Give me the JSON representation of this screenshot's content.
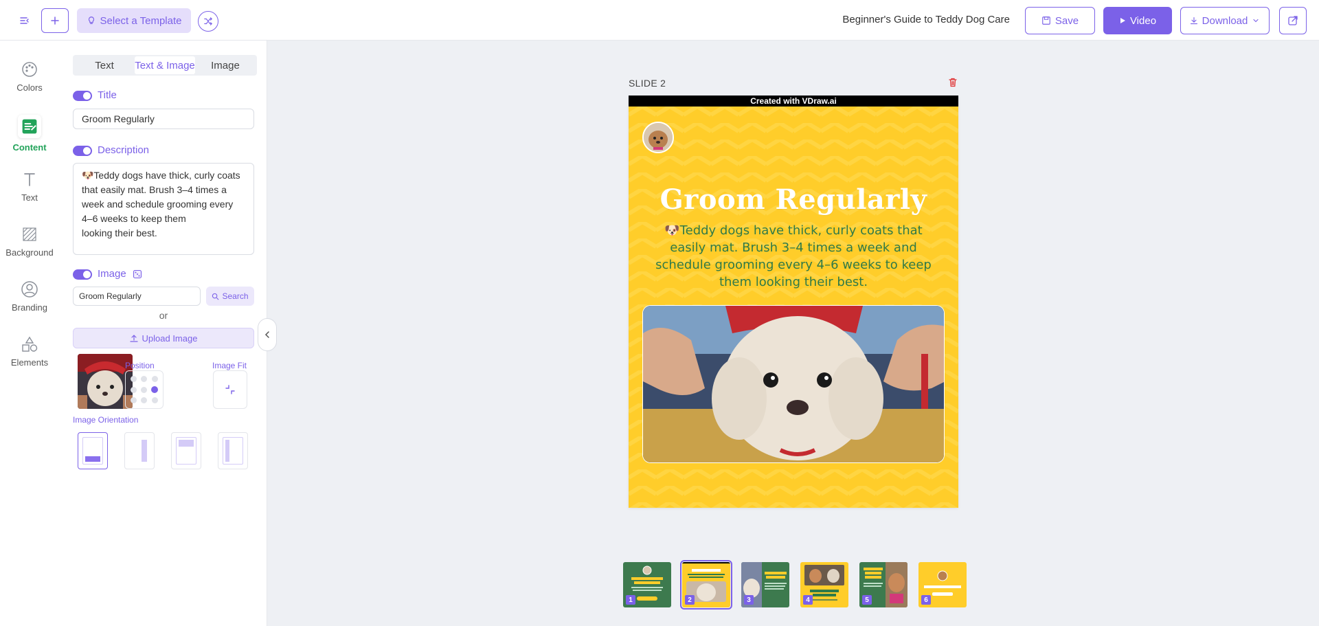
{
  "topbar": {
    "template_label": "Select a Template",
    "doc_title": "Beginner's Guide to Teddy Dog Care",
    "save_label": "Save",
    "video_label": "Video",
    "download_label": "Download"
  },
  "rail": {
    "items": [
      {
        "label": "Colors",
        "icon": "palette-icon"
      },
      {
        "label": "Content",
        "icon": "content-edit-icon"
      },
      {
        "label": "Text",
        "icon": "text-icon"
      },
      {
        "label": "Background",
        "icon": "background-pattern-icon"
      },
      {
        "label": "Branding",
        "icon": "user-circle-icon"
      },
      {
        "label": "Elements",
        "icon": "shapes-icon"
      }
    ],
    "active": "Content"
  },
  "panel": {
    "tabs": [
      "Text",
      "Text & Image",
      "Image"
    ],
    "active_tab": "Text & Image",
    "title_label": "Title",
    "title_value": "Groom Regularly",
    "description_label": "Description",
    "description_value": "🐶Teddy dogs have thick, curly coats that easily mat. Brush 3–4 times a week and schedule grooming every 4–6 weeks to keep them\nlooking their best.",
    "image_label": "Image",
    "image_query": "Groom Regularly",
    "search_label": "Search",
    "or_label": "or",
    "upload_label": "Upload Image",
    "position_label": "Position",
    "fit_label": "Image Fit",
    "orientation_label": "Image Orientation"
  },
  "canvas": {
    "slide_label": "SLIDE 2",
    "watermark": "Created with VDraw.ai",
    "slide_title": "Groom Regularly",
    "slide_description": "🐶Teddy dogs have thick, curly coats that easily mat. Brush 3–4 times a week and schedule grooming every 4–6 weeks to keep them looking their best.",
    "background_color": "#ffcd2a",
    "text_color": "#2f7a48"
  },
  "filmstrip": {
    "slides": [
      {
        "num": "1",
        "title": "Beginner's Guide to Teddy Dog Care",
        "bg": "#3d7a4e"
      },
      {
        "num": "2",
        "title": "Groom Regularly",
        "bg": "#ffcd2a"
      },
      {
        "num": "3",
        "title": "Watch Their Diet",
        "bg": "#3d7a4e"
      },
      {
        "num": "4",
        "title": "Daily Walks Are a Must",
        "bg": "#ffcd2a"
      },
      {
        "num": "5",
        "title": "Start Training Early",
        "bg": "#3d7a4e"
      },
      {
        "num": "6",
        "title": "Hope you give it a like!",
        "bg": "#ffcd2a"
      }
    ],
    "active": "2"
  },
  "colors": {
    "accent": "#7b61e8",
    "active_rail": "#22a35a"
  }
}
